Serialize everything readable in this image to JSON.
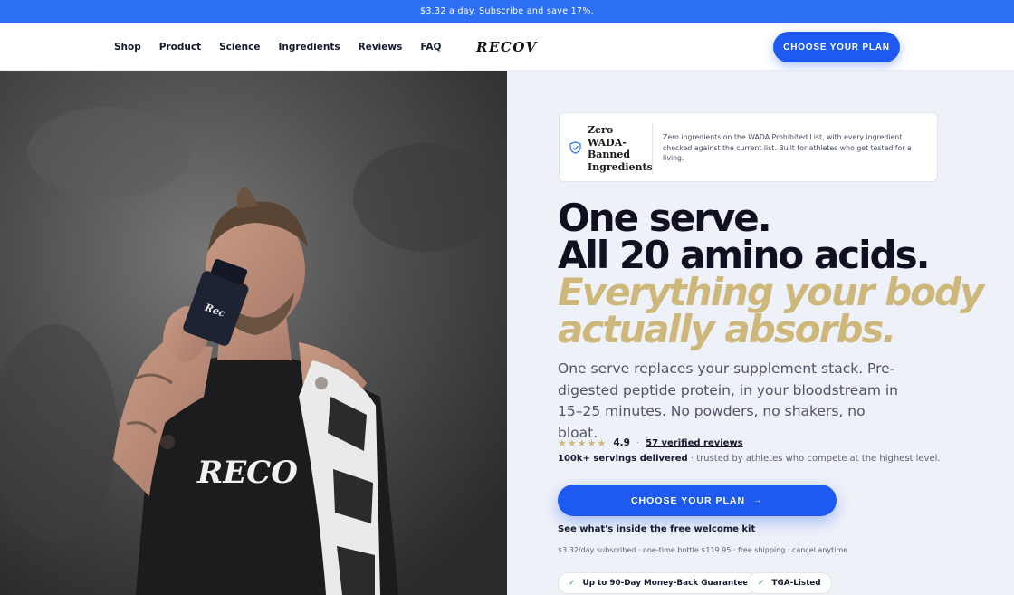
{
  "promo": {
    "text": "$3.32 a day. Subscribe and save 17%."
  },
  "header": {
    "nav": [
      "Shop",
      "Product",
      "Science",
      "Ingredients",
      "Reviews",
      "FAQ"
    ],
    "logo": "RECOV",
    "cta": "CHOOSE YOUR PLAN"
  },
  "hero": {
    "image": "athlete-holding-supplement-bottle",
    "shirt_text": "RECO"
  },
  "badge": {
    "icon": "shield-check-icon",
    "title": "Zero WADA-Banned Ingredients",
    "description": "Zero ingredients on the WADA Prohibited List, with every ingredient checked against the current list. Built for athletes who get tested for a living."
  },
  "headline": {
    "line1": "One serve.",
    "line2": "All 20 amino acids.",
    "accent1": "Everything your body",
    "accent2": "actually absorbs."
  },
  "subtext": "One serve replaces your supplement stack. Pre-digested peptide protein, in your bloodstream in 15–25 minutes. No powders, no shakers, no bloat.",
  "rating": {
    "stars": "★★★★★",
    "score": "4.9",
    "separator": "·",
    "reviews": "57 verified reviews"
  },
  "trust": {
    "bold": "100k+ servings delivered",
    "rest": " · trusted by athletes who compete at the highest level."
  },
  "cta_main": {
    "label": "CHOOSE YOUR PLAN",
    "arrow": "→"
  },
  "kit_link": "See what's inside the free welcome kit",
  "pricing": "$3.32/day subscribed · one-time bottle $119.95 · free shipping · cancel anytime",
  "pills": [
    {
      "check": "✓",
      "label": "Up to 90-Day Money-Back Guarantee"
    },
    {
      "check": "✓",
      "label": "TGA-Listed"
    }
  ],
  "colors": {
    "primary": "#1f5af0",
    "promo": "#2d6ff2",
    "accent_gold": "#cdb77a",
    "panel_bg": "#eef1f8"
  }
}
